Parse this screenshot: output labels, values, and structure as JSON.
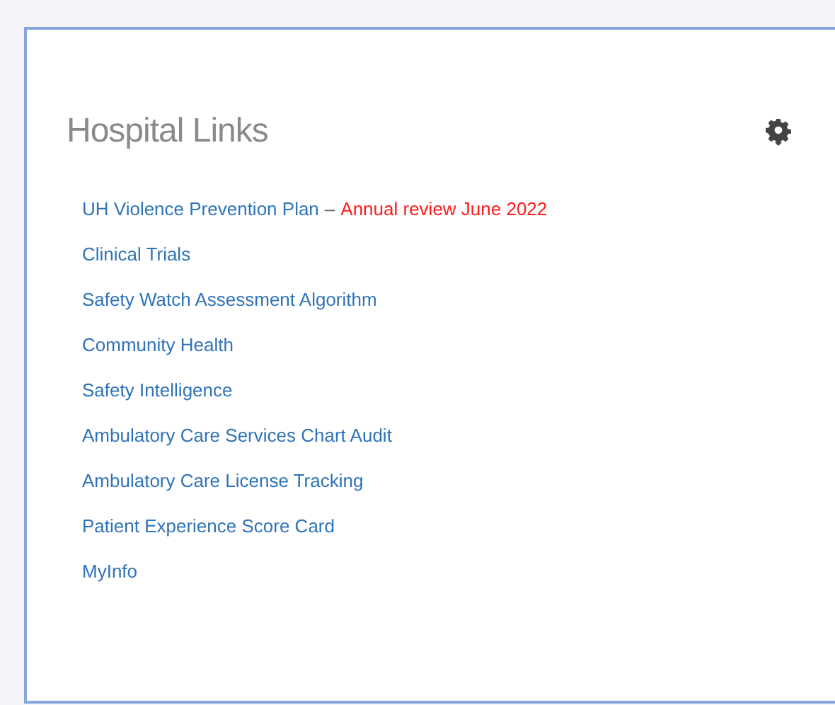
{
  "panel": {
    "title": "Hospital Links",
    "links": [
      {
        "label": "UH Violence Prevention Plan",
        "separator": "–",
        "note": "Annual review June 2022"
      },
      {
        "label": "Clinical Trials"
      },
      {
        "label": "Safety Watch Assessment Algorithm"
      },
      {
        "label": "Community Health"
      },
      {
        "label": "Safety Intelligence"
      },
      {
        "label": "Ambulatory Care Services Chart Audit"
      },
      {
        "label": "Ambulatory Care License Tracking"
      },
      {
        "label": "Patient Experience Score Card"
      },
      {
        "label": "MyInfo"
      }
    ]
  }
}
